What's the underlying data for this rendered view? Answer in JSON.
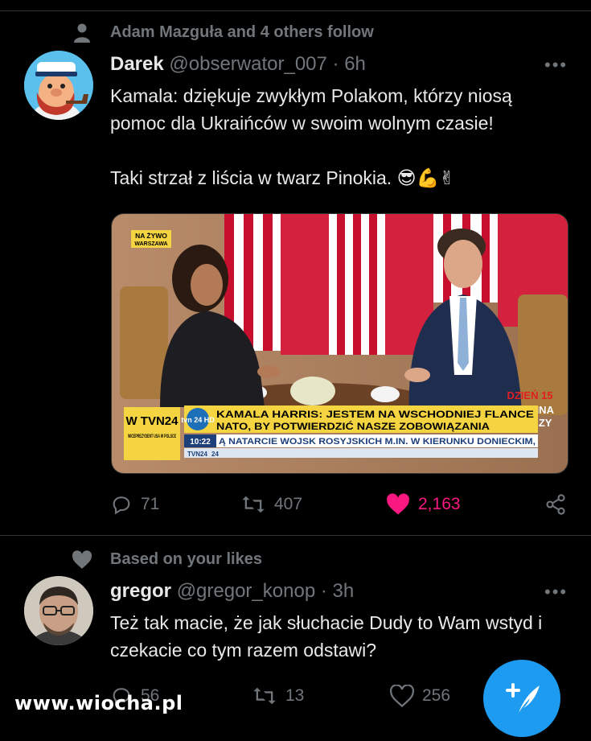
{
  "tweet1": {
    "social_context": "Adam Mazguła and 4 others follow",
    "display_name": "Darek",
    "handle": "@obserwator_007",
    "time": "· 6h",
    "text": "Kamala: dziękuje zwykłym Polakom, którzy niosą pomoc dla Ukraińców w swoim wolnym czasie!\n\nTaki strzał z liścia w twarz Pinokia. 😎💪✌",
    "media": {
      "live_badge": "NA ŻYWO",
      "live_location": "WARSZAWA",
      "channel_logo": "W TVN24",
      "channel_sub": "WICEPREZYDENT USA W POLSCE",
      "headline_line1": "KAMALA HARRIS: JESTEM NA WSCHODNIEJ FLANCE",
      "headline_line2": "NATO, BY POTWIERDZIĆ NASZE ZOBOWIĄZANIA",
      "clock": "10:22",
      "ticker": "Ą NATARCIE WOJSK ROSYJSKICH M.IN. W KIERUNKU DONIECKIM,",
      "ticker_tag": "TVN24",
      "ticker_num": "24",
      "day_badge": "DZIEŃ 15",
      "ukraine_badge_1": "UKRAINA",
      "ukraine_badge_2": "WALCZY",
      "tvn_bug": "tvn 24 HD"
    },
    "replies": "71",
    "retweets": "407",
    "likes": "2,163",
    "liked": true
  },
  "tweet2": {
    "social_context": "Based on your likes",
    "display_name": "gregor",
    "handle": "@gregor_konop",
    "time": "· 3h",
    "text": "Też tak macie, że jak słuchacie Dudy to Wam wstyd i czekacie co tym razem odstawi?",
    "replies": "56",
    "retweets": "13",
    "likes": "256"
  },
  "watermark": "www.wiocha.pl",
  "colors": {
    "accent": "#1d9bf0",
    "like": "#f91880",
    "muted": "#71767b",
    "text": "#e7e9ea",
    "bg": "#000000"
  },
  "icons": [
    "person-icon",
    "more-icon",
    "reply-icon",
    "retweet-icon",
    "like-icon",
    "share-icon",
    "heart-icon",
    "compose-tweet-icon"
  ]
}
